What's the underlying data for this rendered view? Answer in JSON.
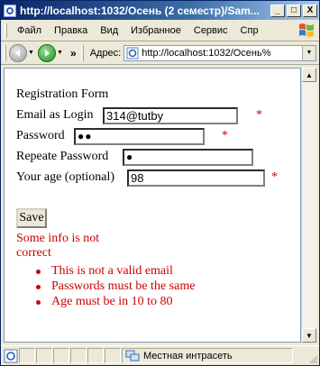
{
  "window": {
    "title": "http://localhost:1032/Осень (2 семестр)/Sam...",
    "controls": {
      "minimize": "_",
      "maximize": "□",
      "close": "X"
    }
  },
  "menubar": {
    "items": [
      {
        "label": "Файл"
      },
      {
        "label": "Правка"
      },
      {
        "label": "Вид"
      },
      {
        "label": "Избранное"
      },
      {
        "label": "Сервис"
      },
      {
        "label": "Спр"
      }
    ]
  },
  "toolbar": {
    "chevron": "»",
    "address_label": "Адрес:",
    "address_value": "http://localhost:1032/Осень%"
  },
  "form": {
    "heading": "Registration Form",
    "email_label": "Email as Login",
    "email_value": "314@tutby",
    "password_label": "Password",
    "password_mask": "●●",
    "repeat_label": "Repeate Password",
    "repeat_mask": "●",
    "age_label": "Your age (optional)",
    "age_value": "98",
    "required_marker": "*",
    "save_label": "Save"
  },
  "errors": {
    "summary": "Some info is not correct",
    "items": [
      "This is not a valid email",
      "Passwords must be the same",
      "Age must be in 10 to 80"
    ]
  },
  "statusbar": {
    "zone_label": "Местная интрасеть"
  },
  "colors": {
    "error": "#cc0000",
    "title_bar": "#0a246a",
    "chrome": "#ece9d8"
  }
}
